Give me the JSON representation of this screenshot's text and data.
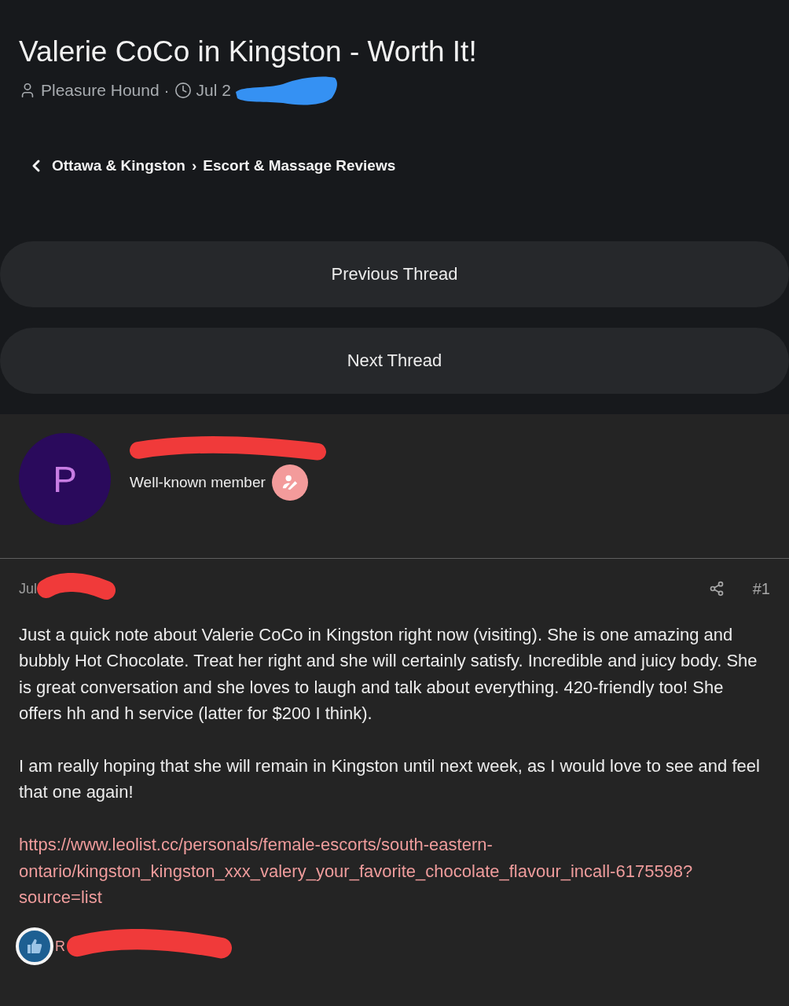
{
  "thread": {
    "title": "Valerie CoCo in Kingston - Worth It!",
    "author": "Pleasure Hound",
    "separator": "·",
    "date": "Jul 2"
  },
  "breadcrumb": {
    "items": [
      "Ottawa & Kingston",
      "Escort & Massage Reviews"
    ],
    "separator": "›"
  },
  "thread_nav": [
    "Previous Thread",
    "Next Thread"
  ],
  "post": {
    "avatar_letter": "P",
    "user_title": "Well-known member",
    "date": "Jul",
    "number": "#1",
    "paragraphs": [
      "Just a quick note about Valerie CoCo in Kingston right now (visiting). She is one amazing and bubbly Hot Chocolate. Treat her right and she will certainly satisfy. Incredible and juicy body. She is great conversation and she loves to laugh and talk about everything. 420-friendly too! She offers hh and h service (latter for $200 I think).",
      "I am really hoping that she will remain in Kingston until next week, as I would love to see and feel that one again!"
    ],
    "link": "https://www.leolist.cc/personals/female-escorts/south-eastern-ontario/kingston_kingston_xxx_valery_your_favorite_chocolate_flavour_incall-6175598?source=list",
    "reactions": "R"
  }
}
